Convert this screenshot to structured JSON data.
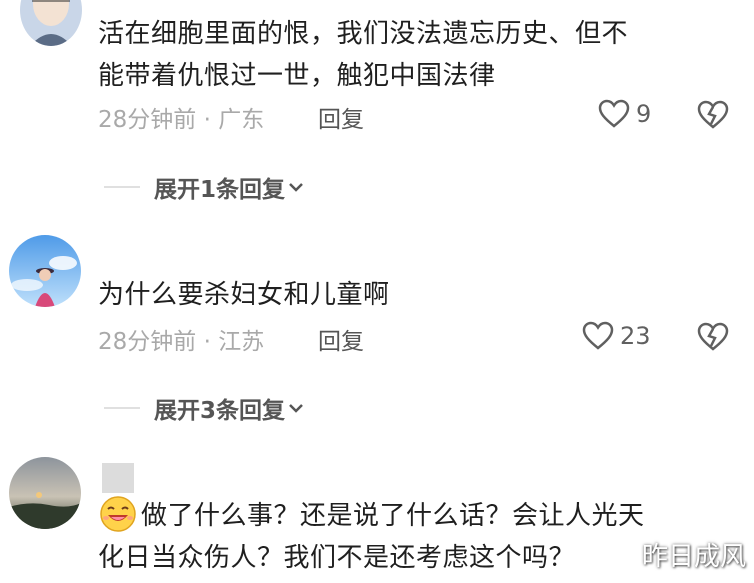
{
  "comments": [
    {
      "text_lines": [
        "活在细胞里面的恨，我们没法遗忘历史、但不",
        "能带着仇恨过一世，触犯中国法律"
      ],
      "time": "28分钟前",
      "location": "广东",
      "reply_label": "回复",
      "likes": "9",
      "expand_label": "展开1条回复"
    },
    {
      "text_lines": [
        "为什么要杀妇女和儿童啊"
      ],
      "time": "28分钟前",
      "location": "江苏",
      "reply_label": "回复",
      "likes": "23",
      "expand_label": "展开3条回复"
    },
    {
      "text_lines": [
        "做了什么事？还是说了什么话？会让人光天",
        "化日当众伤人？我们不是还考虑这个吗？"
      ]
    }
  ],
  "meta_separator": " · ",
  "watermark": "昨日成风",
  "icons": {
    "like": "heart-outline-icon",
    "dislike": "broken-heart-icon",
    "expand": "chevron-down-icon",
    "emoji": "laughing-emoji-icon"
  },
  "colors": {
    "text": "#1f1f1f",
    "meta": "#a9a9a9",
    "action": "#555555"
  }
}
